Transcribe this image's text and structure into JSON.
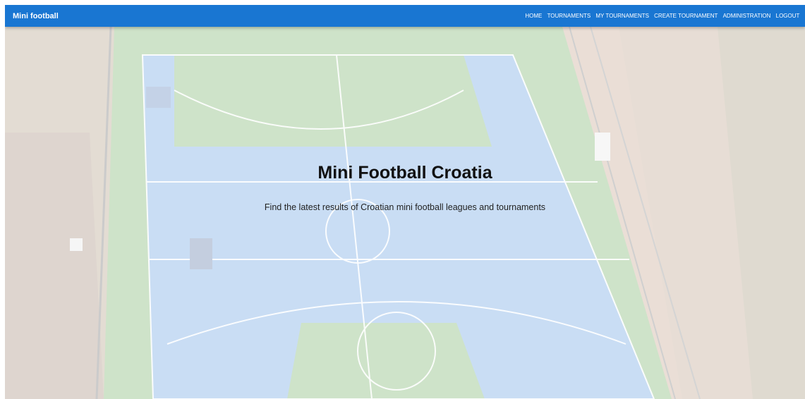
{
  "header": {
    "brand": "Mini football",
    "nav": [
      {
        "label": "HOME"
      },
      {
        "label": "TOURNAMENTS"
      },
      {
        "label": "MY TOURNAMENTS"
      },
      {
        "label": "CREATE TOURNAMENT"
      },
      {
        "label": "ADMINISTRATION"
      },
      {
        "label": "LOGOUT"
      }
    ]
  },
  "hero": {
    "title": "Mini Football Croatia",
    "subtitle": "Find the latest results of Croatian mini football leagues and tournaments"
  },
  "colors": {
    "appbar": "#1976d2",
    "court_blue": "#5aa0e6",
    "court_green": "#6ab04c",
    "surround": "#b98a6a"
  }
}
